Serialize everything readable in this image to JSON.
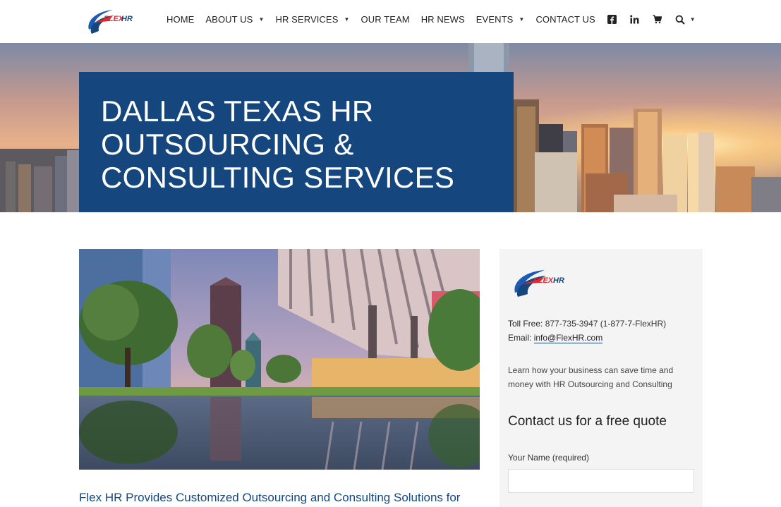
{
  "brand": {
    "logo_text": "FLEX HR",
    "colors": {
      "primary": "#15467d",
      "accent_red": "#e5262f",
      "accent_blue": "#1d5bb0"
    }
  },
  "nav": {
    "items": [
      {
        "label": "HOME",
        "has_dropdown": false
      },
      {
        "label": "ABOUT US",
        "has_dropdown": true
      },
      {
        "label": "HR SERVICES",
        "has_dropdown": true
      },
      {
        "label": "OUR TEAM",
        "has_dropdown": false
      },
      {
        "label": "HR NEWS",
        "has_dropdown": false
      },
      {
        "label": "EVENTS",
        "has_dropdown": true
      },
      {
        "label": "CONTACT US",
        "has_dropdown": false
      }
    ],
    "icons": [
      "facebook-icon",
      "linkedin-icon",
      "cart-icon",
      "search-icon"
    ]
  },
  "hero": {
    "title": "DALLAS TEXAS HR OUTSOURCING & CONSULTING SERVICES"
  },
  "main": {
    "intro": "Flex HR Provides Customized Outsourcing and Consulting Solutions for"
  },
  "sidebar": {
    "toll_free_label": "Toll Free:",
    "toll_free_value": "877-735-3947 (1-877-7-FlexHR)",
    "email_label": "Email:",
    "email_value": "info@FlexHR.com",
    "blurb": "Learn how your business can save time and money with HR Outsourcing and Consulting",
    "quote_heading": "Contact us for a free quote",
    "name_label": "Your Name (required)",
    "name_value": ""
  }
}
